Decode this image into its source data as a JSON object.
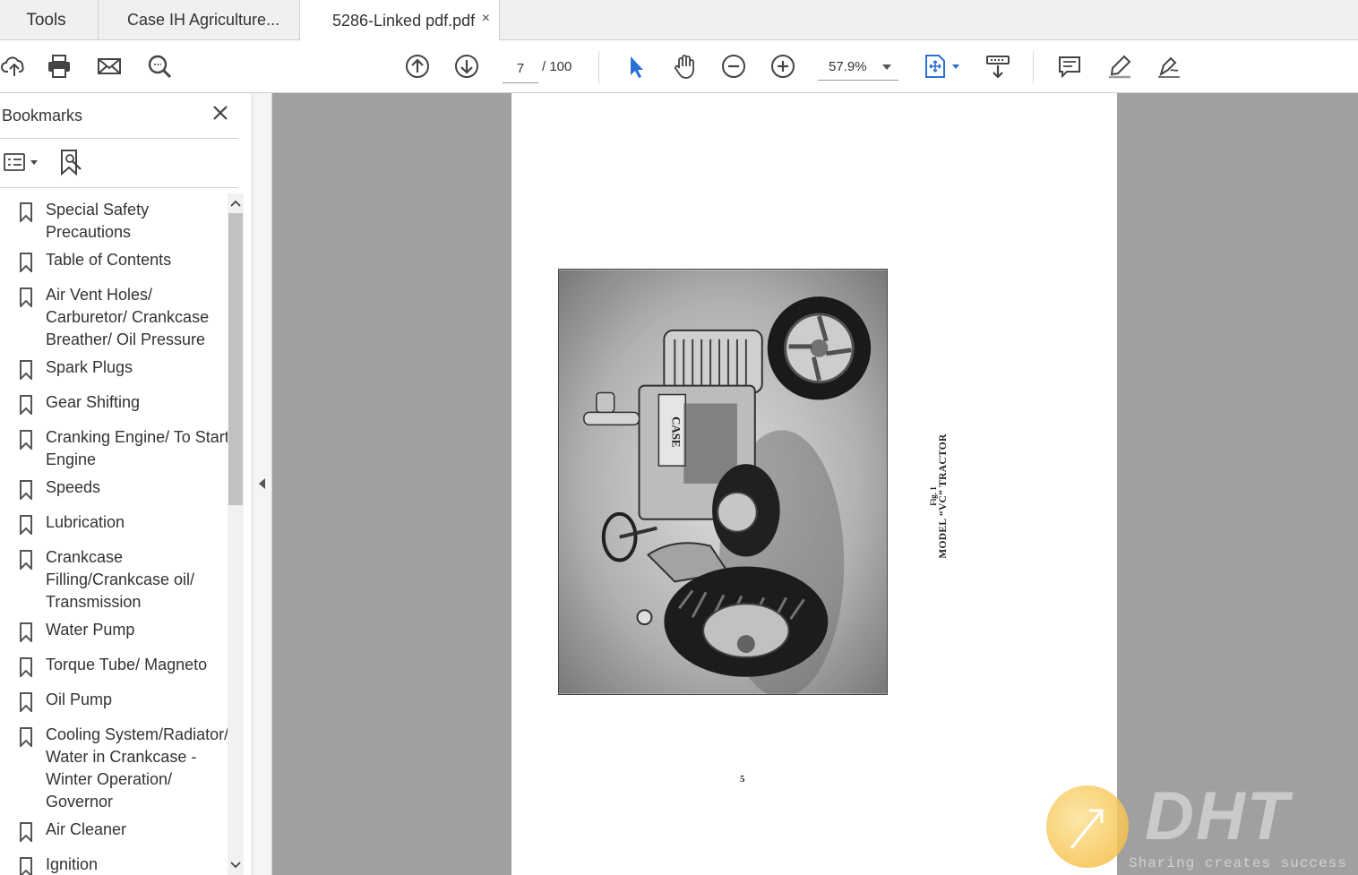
{
  "tabs": {
    "tools": "Tools",
    "doc1": "Case IH Agriculture...",
    "doc2": "5286-Linked pdf.pdf",
    "close_glyph": "×"
  },
  "toolbar": {
    "page_current": "7",
    "page_total": "/  100",
    "zoom": "57.9%",
    "icons": [
      "upload-cloud-icon",
      "print-icon",
      "mail-icon",
      "search-zoom-icon",
      "prev-page-icon",
      "next-page-icon",
      "select-cursor-icon",
      "hand-icon",
      "zoom-out-icon",
      "zoom-in-icon",
      "fit-page-icon",
      "scroll-mode-icon",
      "comment-icon",
      "highlight-icon",
      "sign-icon"
    ],
    "accent": "#2a6fd6"
  },
  "bookmarks_panel": {
    "title": "Bookmarks",
    "items": [
      {
        "label": "Special Safety Precautions"
      },
      {
        "label": "Table of Contents"
      },
      {
        "label": "Air Vent Holes/ Carburetor/ Crankcase Breather/ Oil Pressure"
      },
      {
        "label": "Spark Plugs"
      },
      {
        "label": "Gear Shifting"
      },
      {
        "label": "Cranking Engine/ To Start Engine"
      },
      {
        "label": "Speeds"
      },
      {
        "label": "Lubrication"
      },
      {
        "label": "Crankcase Filling/Crankcase oil/ Transmission"
      },
      {
        "label": "Water Pump"
      },
      {
        "label": "Torque Tube/ Magneto"
      },
      {
        "label": "Oil Pump"
      },
      {
        "label": "Cooling System/Radiator/ Water in Crankcase - Winter Operation/ Governor"
      },
      {
        "label": "Air Cleaner"
      },
      {
        "label": "Ignition"
      }
    ]
  },
  "document": {
    "fig_label": "Fig. 1",
    "caption": "MODEL “VC” TRACTOR",
    "page_number": "5",
    "tractor_brand": "CASE"
  },
  "watermark": {
    "text": "DHT",
    "subtext": "Sharing creates success"
  }
}
